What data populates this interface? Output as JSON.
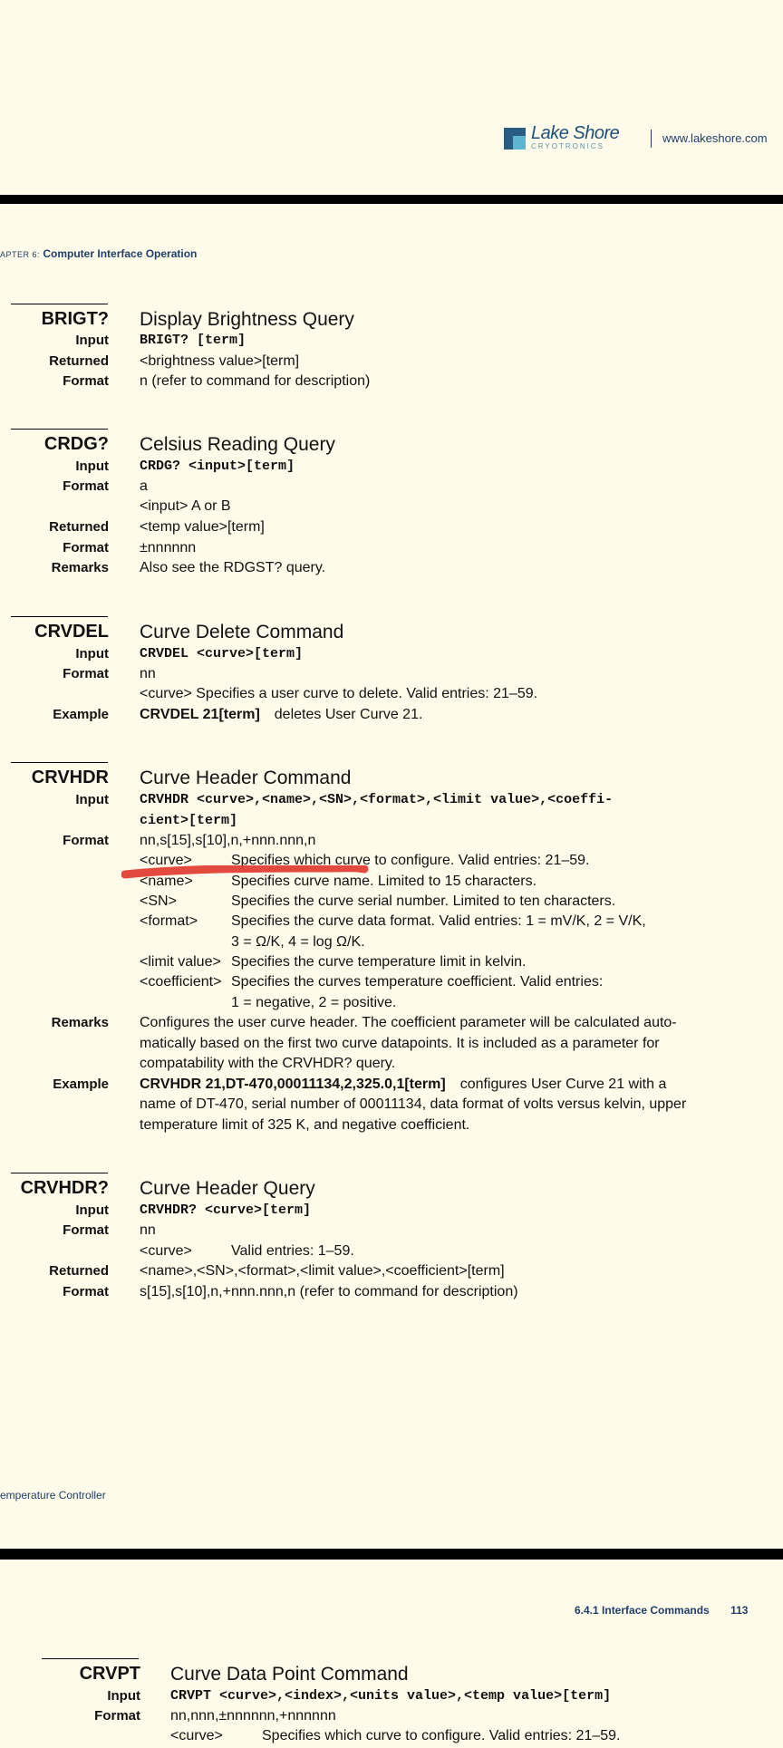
{
  "header": {
    "logo_name": "Lake Shore",
    "logo_sub": "CRYOTRONICS",
    "url": "www.lakeshore.com"
  },
  "chapter": {
    "prefix": "APTER 6:",
    "title": "Computer Interface Operation"
  },
  "sections": {
    "brigt": {
      "cmd": "BRIGT?",
      "title": "Display Brightness Query",
      "input_label": "Input",
      "input": "BRIGT? [term]",
      "returned_label": "Returned",
      "returned": "<brightness value>[term]",
      "format_label": "Format",
      "format": "n (refer to command for description)"
    },
    "crdg": {
      "cmd": "CRDG?",
      "title": "Celsius Reading Query",
      "input_label": "Input",
      "input": "CRDG? <input>[term]",
      "format_label": "Format",
      "format": "a",
      "sub_param": "<input>",
      "sub_desc": "A or B",
      "returned_label": "Returned",
      "returned": "<temp value>[term]",
      "format2_label": "Format",
      "format2": "±nnnnnn",
      "remarks_label": "Remarks",
      "remarks": "Also see the RDGST? query."
    },
    "crvdel": {
      "cmd": "CRVDEL",
      "title": "Curve Delete Command",
      "input_label": "Input",
      "input": "CRVDEL <curve>[term]",
      "format_label": "Format",
      "format": "nn",
      "sub_line": "<curve> Specifies a user curve to delete. Valid entries: 21–59.",
      "example_label": "Example",
      "example_cmd": "CRVDEL 21[term]",
      "example_desc": "deletes User Curve 21."
    },
    "crvhdr": {
      "cmd": "CRVHDR",
      "title": "Curve Header Command",
      "input_label": "Input",
      "input": "CRVHDR <curve>,<name>,<SN>,<format>,<limit value>,<coeffi-",
      "input2": "cient>[term]",
      "format_label": "Format",
      "format": "nn,s[15],s[10],n,+nnn.nnn,n",
      "params": [
        {
          "name": "<curve>",
          "desc": "Specifies which curve to configure. Valid entries: 21–59."
        },
        {
          "name": "<name>",
          "desc": "Specifies curve name. Limited to 15 characters."
        },
        {
          "name": "<SN>",
          "desc": "Specifies the curve serial number. Limited to ten characters."
        },
        {
          "name": "<format>",
          "desc": "Specifies the curve data format. Valid entries: 1 = mV/K, 2 = V/K,"
        },
        {
          "name": "",
          "desc": "3 = Ω/K, 4 = log Ω/K."
        },
        {
          "name": "<limit value>",
          "desc": "Specifies the curve temperature limit in kelvin."
        },
        {
          "name": "<coefficient>",
          "desc": "Specifies the curves temperature coefficient. Valid entries:"
        },
        {
          "name": "",
          "desc": "1 = negative, 2 = positive."
        }
      ],
      "remarks_label": "Remarks",
      "remarks": [
        "Configures the user curve header. The coefficient parameter will be calculated auto-",
        "matically based on the first two curve datapoints. It is included as a parameter for",
        "compatability with the CRVHDR? query."
      ],
      "example_label": "Example",
      "example_cmd": "CRVHDR 21,DT-470,00011134,2,325.0,1[term]",
      "example_desc": "configures User Curve 21 with a",
      "example_lines": [
        "name of DT-470, serial number of 00011134, data format of volts versus kelvin, upper",
        "temperature limit of 325 K, and negative coefficient."
      ]
    },
    "crvhdrq": {
      "cmd": "CRVHDR?",
      "title": "Curve Header Query",
      "input_label": "Input",
      "input": "CRVHDR? <curve>[term]",
      "format_label": "Format",
      "format": "nn",
      "sub_param": "<curve>",
      "sub_desc": "Valid entries: 1–59.",
      "returned_label": "Returned",
      "returned": "<name>,<SN>,<format>,<limit value>,<coefficient>[term]",
      "format2_label": "Format",
      "format2": "s[15],s[10],n,+nnn.nnn,n (refer to command for description)"
    },
    "crvpt": {
      "cmd": "CRVPT",
      "title": "Curve Data Point Command",
      "input_label": "Input",
      "input": "CRVPT <curve>,<index>,<units value>,<temp value>[term]",
      "format_label": "Format",
      "format": "nn,nnn,±nnnnnn,+nnnnnn",
      "sub_param": "<curve>",
      "sub_desc": "Specifies which curve to configure. Valid entries: 21–59."
    }
  },
  "footer": {
    "left": "emperature Controller",
    "right_section": "6.4.1 Interface Commands",
    "page_number": "113"
  },
  "annotation_color": "#e03a30"
}
